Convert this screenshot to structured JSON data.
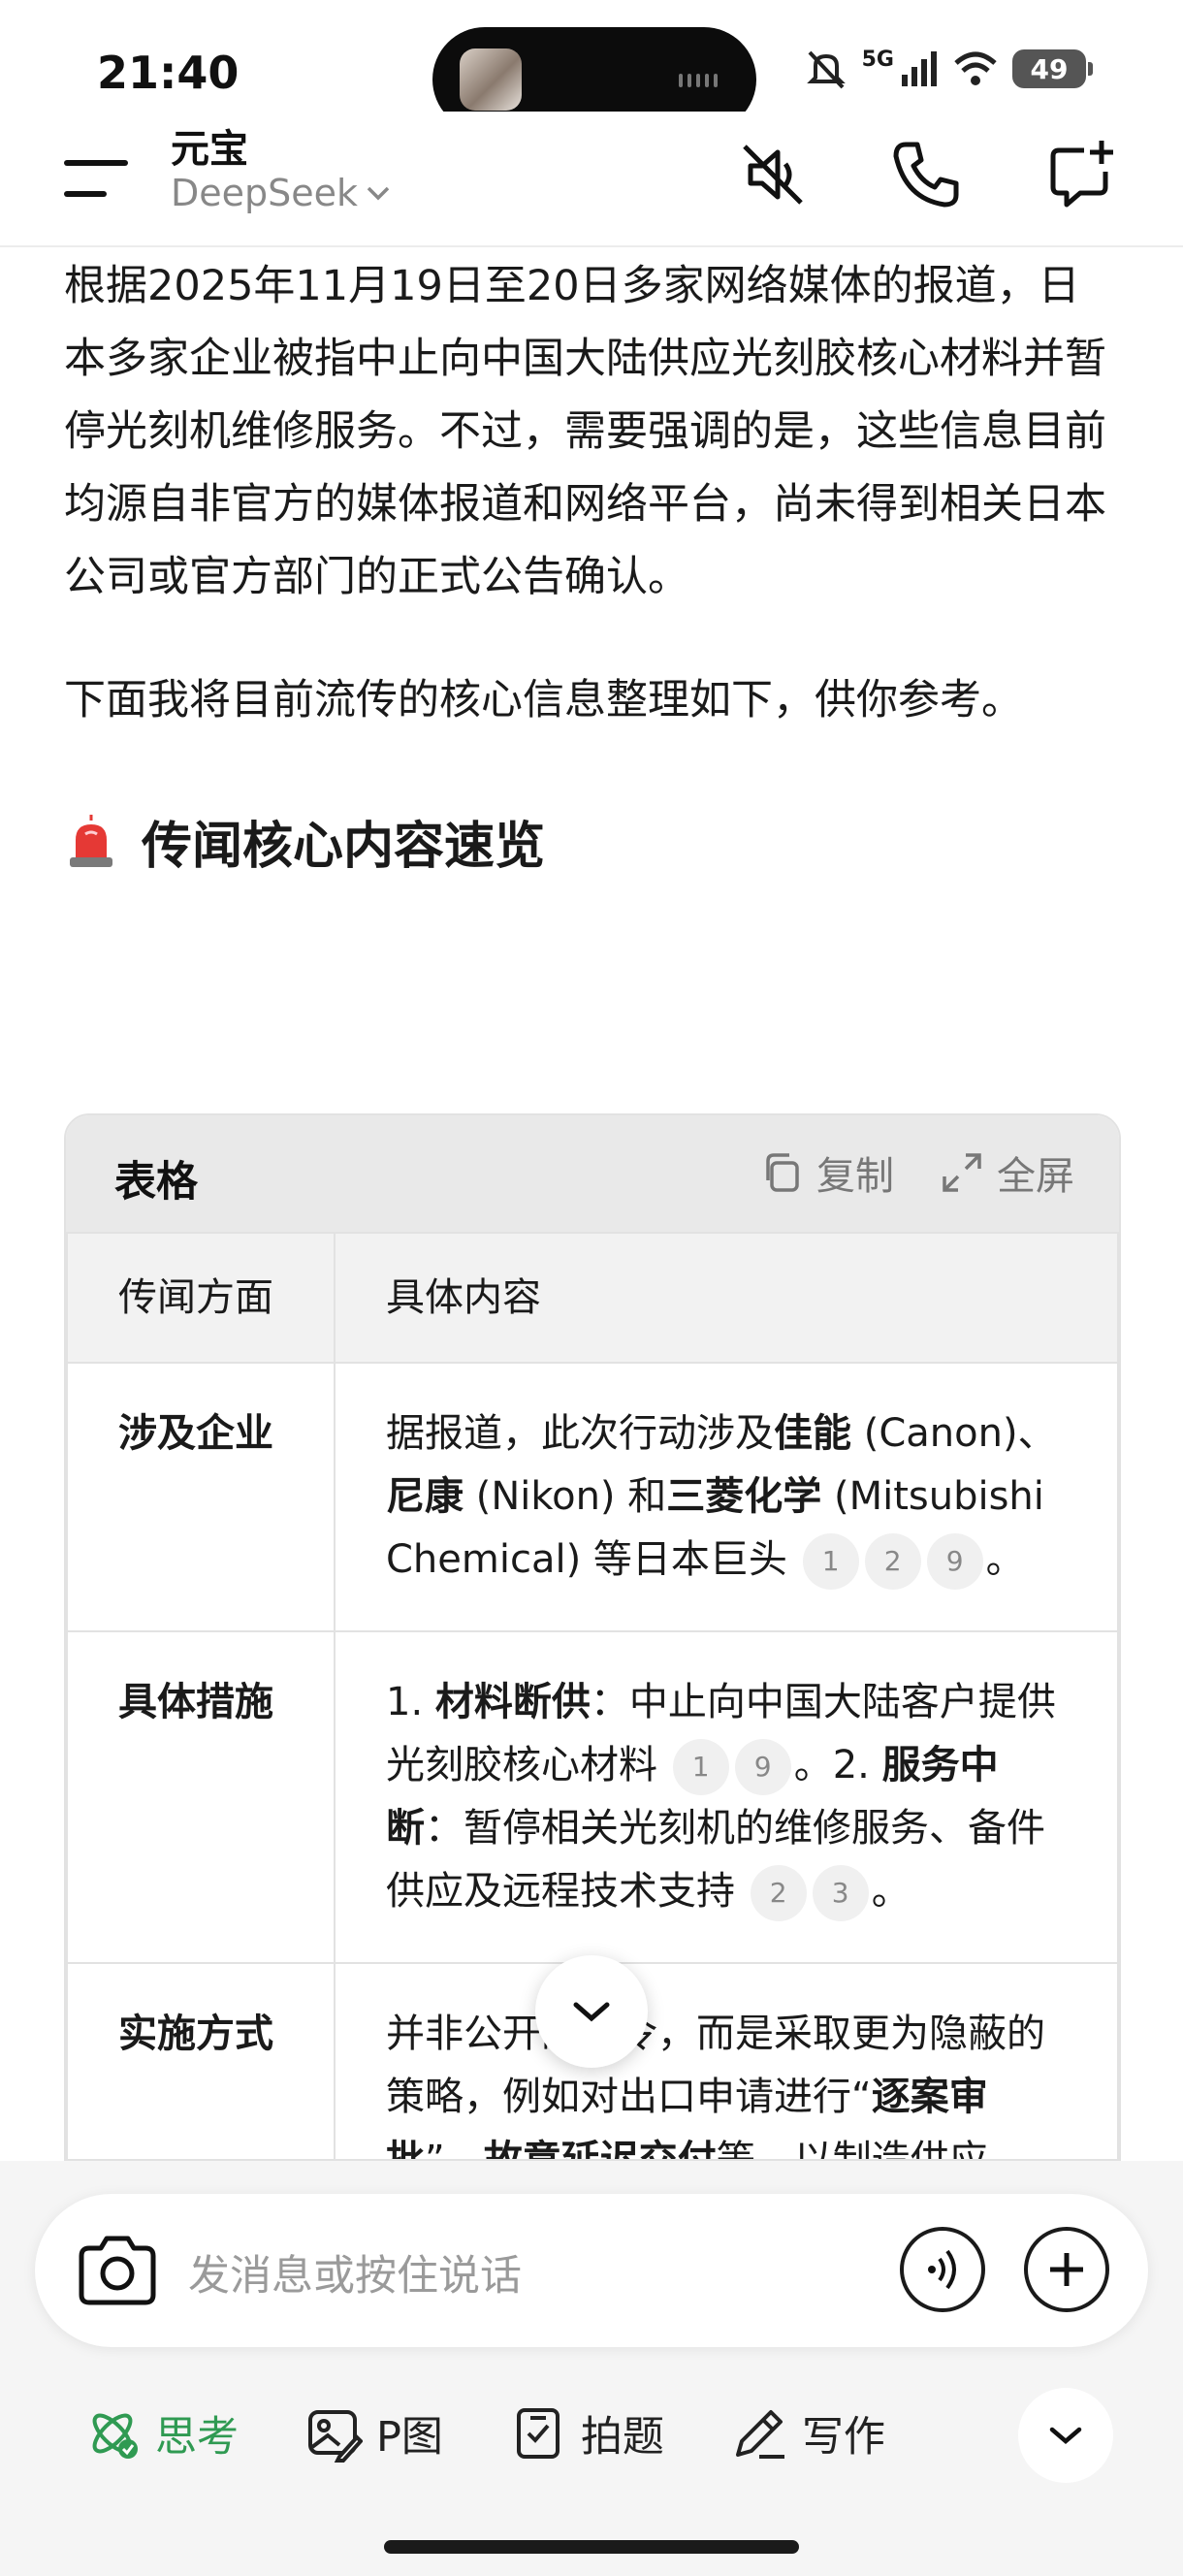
{
  "status": {
    "time": "21:40",
    "network": "5G",
    "battery": "49"
  },
  "header": {
    "title": "元宝",
    "model": "DeepSeek"
  },
  "content": {
    "para1": "根据2025年11月19日至20日多家网络媒体的报道，日本多家企业被指中止向中国大陆供应光刻胶核心材料并暂停光刻机维修服务。不过，需要强调的是，这些信息目前均源自非官方的媒体报道和网络平台，尚未得到相关日本公司或官方部门的正式公告确认。",
    "para2": "下面我将目前流传的核心信息整理如下，供你参考。",
    "section_title": "传闻核心内容速览"
  },
  "table": {
    "title": "表格",
    "copy_label": "复制",
    "fullscreen_label": "全屏",
    "col1": "传闻方面",
    "col2": "具体内容",
    "rows": [
      {
        "key": "涉及企业",
        "t1": "据报道，此次行动涉及",
        "b1": "佳能",
        "t2": " (Canon)、",
        "b2": "尼康",
        "t3": " (Nikon) 和",
        "b3": "三菱化学",
        "t4": " (Mitsubishi Chemical) 等日本巨头",
        "cites": [
          "1",
          "2",
          "9"
        ],
        "end": "。"
      },
      {
        "key": "具体措施",
        "t1": "1. ",
        "b1": "材料断供",
        "t2": "：中止向中国大陆客户提供光刻胶核心材料",
        "cites1": [
          "1",
          "9"
        ],
        "t3": "。2. ",
        "b2": "服务中断",
        "t4": "：暂停相关光刻机的维修服务、备件供应及远程技术支持",
        "cites2": [
          "2",
          "3"
        ],
        "end": "。"
      },
      {
        "key": "实施方式",
        "t1": "并非公开的禁令，而是采取更为隐蔽的策略，例如对出口申请进行“",
        "b1": "逐案审批",
        "t2": "”、",
        "b2": "故意延迟交付",
        "t3": "等，以制造供应"
      }
    ]
  },
  "input": {
    "placeholder": "发消息或按住说话"
  },
  "tools": [
    {
      "label": "思考",
      "icon": "think-icon"
    },
    {
      "label": "P图",
      "icon": "image-edit-icon"
    },
    {
      "label": "拍题",
      "icon": "scan-question-icon"
    },
    {
      "label": "写作",
      "icon": "pen-icon"
    }
  ],
  "colors": {
    "accent_green": "#2f9a52",
    "text": "#1a1a1a",
    "muted": "#9a9a9a"
  }
}
